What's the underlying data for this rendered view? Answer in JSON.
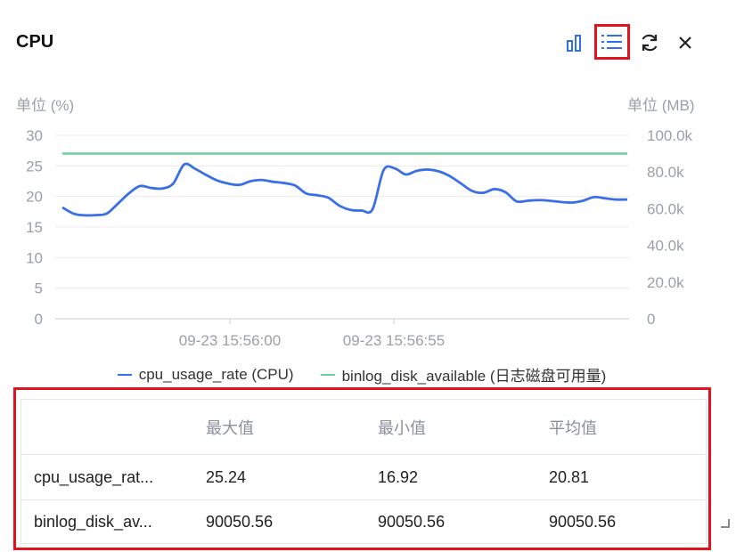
{
  "panel": {
    "title": "CPU",
    "tools": [
      {
        "name": "bar-chart-toggle",
        "icon": "bar-chart-icon"
      },
      {
        "name": "list-toggle",
        "icon": "list-icon"
      },
      {
        "name": "refresh",
        "icon": "refresh-icon"
      },
      {
        "name": "close",
        "icon": "close-icon"
      }
    ],
    "left_unit": "单位 (%)",
    "right_unit": "单位 (MB)"
  },
  "colors": {
    "accent": "#2f6fe8",
    "cpu_series": "#3b6fe6",
    "disk_series": "#6fcf97",
    "highlight": "#e0141e"
  },
  "chart_data": {
    "type": "line",
    "y_left": {
      "label": "单位 (%)",
      "ylim": [
        0,
        30
      ],
      "ticks": [
        "0",
        "5",
        "10",
        "15",
        "20",
        "25",
        "30"
      ]
    },
    "y_right": {
      "label": "单位 (MB)",
      "ylim": [
        0,
        100000
      ],
      "ticks": [
        "0",
        "20.0k",
        "40.0k",
        "60.0k",
        "80.0k",
        "100.0k"
      ]
    },
    "x_ticks": [
      "09-23 15:56:00",
      "09-23 15:56:55"
    ],
    "grid": true,
    "legend_placement": "bottom",
    "series": [
      {
        "name": "cpu_usage_rate (CPU)",
        "axis": "left",
        "values": [
          18.2,
          17.2,
          16.92,
          16.95,
          17.2,
          18.8,
          20.5,
          21.7,
          21.4,
          21.3,
          22.1,
          25.24,
          24.5,
          23.5,
          22.6,
          22.1,
          21.9,
          22.5,
          22.7,
          22.4,
          22.2,
          21.8,
          20.5,
          20.2,
          19.8,
          18.5,
          17.8,
          17.7,
          17.9,
          24.3,
          24.6,
          23.6,
          24.2,
          24.4,
          24.1,
          23.3,
          22.1,
          20.9,
          20.6,
          21.2,
          20.7,
          19.2,
          19.3,
          19.4,
          19.3,
          19.1,
          19.0,
          19.3,
          19.9,
          19.7,
          19.5,
          19.5
        ]
      },
      {
        "name": "binlog_disk_available (日志磁盘可用量)",
        "axis": "right",
        "values": [
          90050.56,
          90050.56
        ]
      }
    ]
  },
  "legend": [
    {
      "label": "cpu_usage_rate (CPU)",
      "color": "#3b6fe6"
    },
    {
      "label": "binlog_disk_available (日志磁盘可用量)",
      "color": "#6fcf97"
    }
  ],
  "table": {
    "headers": [
      "",
      "最大值",
      "最小值",
      "平均值"
    ],
    "rows": [
      {
        "name": "cpu_usage_rat...",
        "max": "25.24",
        "min": "16.92",
        "avg": "20.81"
      },
      {
        "name": "binlog_disk_av...",
        "max": "90050.56",
        "min": "90050.56",
        "avg": "90050.56"
      }
    ]
  }
}
